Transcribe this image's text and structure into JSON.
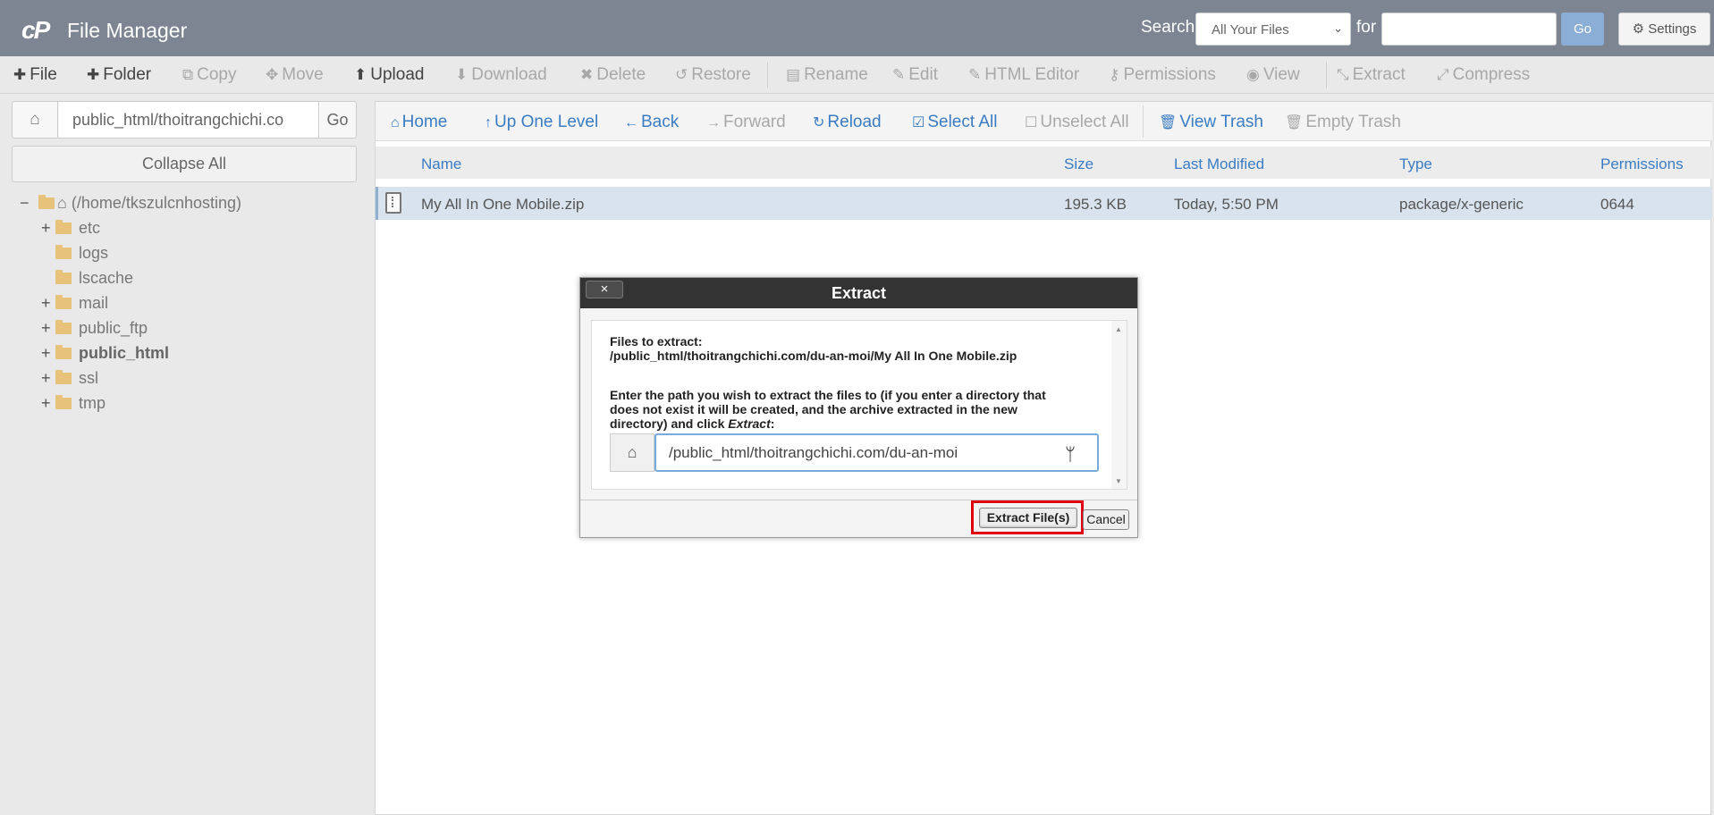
{
  "header": {
    "logo": "cP",
    "title": "File Manager",
    "search_label": "Search",
    "search_scope": "All Your Files",
    "for_label": "for",
    "search_value": "",
    "go_label": "Go",
    "settings_label": "Settings"
  },
  "toolbar": {
    "file": "File",
    "folder": "Folder",
    "copy": "Copy",
    "move": "Move",
    "upload": "Upload",
    "download": "Download",
    "delete": "Delete",
    "restore": "Restore",
    "rename": "Rename",
    "edit": "Edit",
    "html_editor": "HTML Editor",
    "permissions": "Permissions",
    "view": "View",
    "extract": "Extract",
    "compress": "Compress"
  },
  "sidebar": {
    "path_value": "public_html/thoitrangchichi.co",
    "go_label": "Go",
    "collapse_label": "Collapse All",
    "tree": [
      {
        "label": "(/home/tkszulcnhosting)",
        "toggle": "−"
      },
      {
        "label": "etc",
        "toggle": "+"
      },
      {
        "label": "logs",
        "toggle": ""
      },
      {
        "label": "lscache",
        "toggle": ""
      },
      {
        "label": "mail",
        "toggle": "+"
      },
      {
        "label": "public_ftp",
        "toggle": "+"
      },
      {
        "label": "public_html",
        "toggle": "+"
      },
      {
        "label": "ssl",
        "toggle": "+"
      },
      {
        "label": "tmp",
        "toggle": "+"
      }
    ]
  },
  "nav": {
    "home": "Home",
    "up": "Up One Level",
    "back": "Back",
    "forward": "Forward",
    "reload": "Reload",
    "select_all": "Select All",
    "unselect_all": "Unselect All",
    "view_trash": "View Trash",
    "empty_trash": "Empty Trash"
  },
  "table": {
    "columns": [
      "Name",
      "Size",
      "Last Modified",
      "Type",
      "Permissions"
    ],
    "rows": [
      {
        "name": "My All In One Mobile.zip",
        "size": "195.3 KB",
        "modified": "Today, 5:50 PM",
        "type": "package/x-generic",
        "perms": "0644"
      }
    ]
  },
  "dialog": {
    "title": "Extract",
    "close": "×",
    "files_label": "Files to extract:",
    "file_path": "/public_html/thoitrangchichi.com/du-an-moi/My All In One Mobile.zip",
    "instruction_1": "Enter the path you wish to extract the files to (if you enter a directory that",
    "instruction_2": "does not exist it will be created, and the archive extracted in the new",
    "instruction_3a": "directory) and click ",
    "instruction_3b": "Extract",
    "instruction_3c": ":",
    "target_path": "/public_html/thoitrangchichi.com/du-an-moi",
    "extract_button": "Extract File(s)",
    "cancel_button": "Cancel"
  },
  "colors": {
    "header_bg": "#7c8591",
    "link_blue": "#3a7cc2",
    "highlight_red": "#e00010",
    "selected_row": "#d8e3ee"
  }
}
